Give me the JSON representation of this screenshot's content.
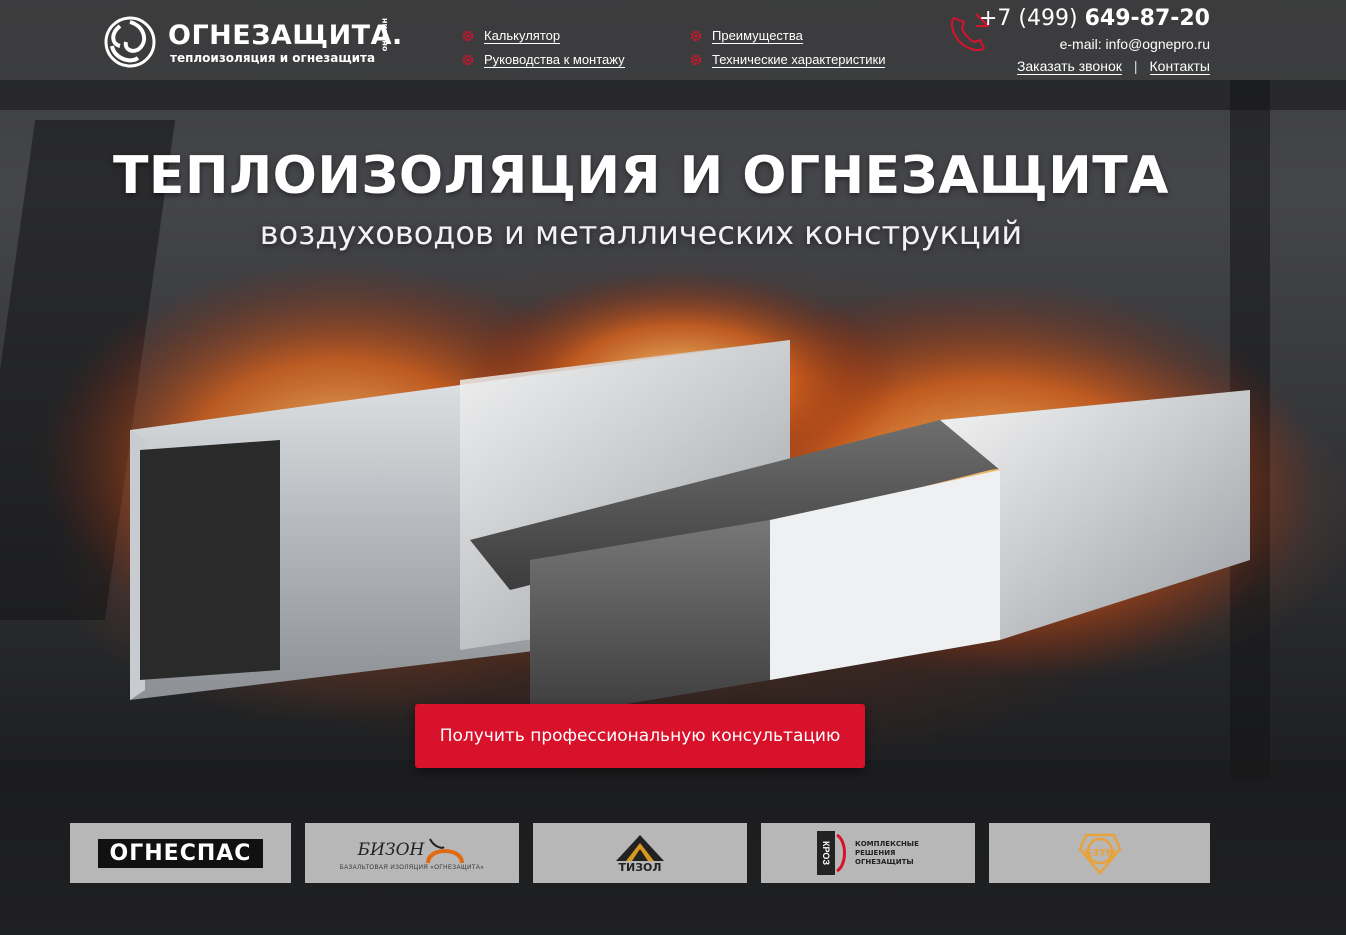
{
  "brand": {
    "title": "ОГНЕЗАЩИТА.",
    "subtitle": "теплоизоляция и огнезащита",
    "vertical_tag": "онлайн",
    "accent_color": "#d8122b"
  },
  "nav": {
    "col1": [
      {
        "label": "Калькулятор",
        "icon": "gear-icon"
      },
      {
        "label": "Руководства к монтажу",
        "icon": "gear-icon"
      }
    ],
    "col2": [
      {
        "label": "Преимущества",
        "icon": "gear-icon"
      },
      {
        "label": "Технические характеристики",
        "icon": "gear-icon"
      }
    ]
  },
  "contacts": {
    "phone_prefix": "+7 (499) ",
    "phone_number": "649-87-20",
    "email": "e-mail: info@ognepro.ru",
    "callback_label": "Заказать звонок",
    "separator": "|",
    "contacts_label": "Контакты"
  },
  "hero": {
    "title": "ТЕПЛОИЗОЛЯЦИЯ И ОГНЕЗАЩИТА",
    "subtitle": "воздуховодов и металлических конструкций",
    "cta_label": "Получить профессиональную консультацию"
  },
  "partners": [
    {
      "name": "ОГНЕСПАС"
    },
    {
      "name": "БИЗОН",
      "tagline": "БАЗАЛЬТОВАЯ ИЗОЛЯЦИЯ «ОГНЕЗАЩИТА»"
    },
    {
      "name": "ТИЗОЛ"
    },
    {
      "name": "КРОЗ",
      "tagline": "КОМПЛЕКСНЫЕ РЕШЕНИЯ ОГНЕЗАЩИТЫ"
    },
    {
      "name": "БЗТМ"
    }
  ]
}
